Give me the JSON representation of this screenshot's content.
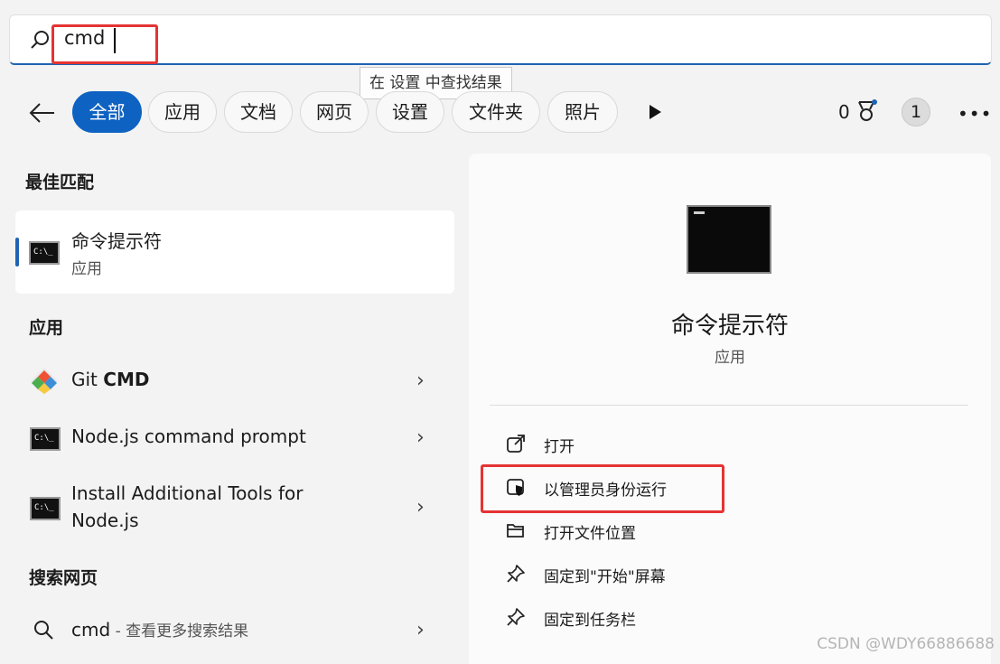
{
  "search": {
    "query": "cmd"
  },
  "tooltip": "在 设置 中查找结果",
  "filters": [
    "全部",
    "应用",
    "文档",
    "网页",
    "设置",
    "文件夹",
    "照片"
  ],
  "header": {
    "reward_count": "0",
    "avatar_label": "1"
  },
  "best_match": {
    "section_title": "最佳匹配",
    "title": "命令提示符",
    "subtitle": "应用",
    "icon_text": "C:\\_"
  },
  "apps": {
    "section_title": "应用",
    "items": [
      {
        "title_plain": "Git ",
        "title_bold": "CMD"
      },
      {
        "title_plain": "Node.js command prompt",
        "icon_text": "C:\\_"
      },
      {
        "title_line1": "Install Additional Tools for",
        "title_line2": "Node.js",
        "icon_text": "C:\\_"
      }
    ]
  },
  "web_search": {
    "section_title": "搜索网页",
    "query": "cmd",
    "suffix": " - 查看更多搜索结果"
  },
  "detail": {
    "title": "命令提示符",
    "subtitle": "应用",
    "actions": [
      "打开",
      "以管理员身份运行",
      "打开文件位置",
      "固定到\"开始\"屏幕",
      "固定到任务栏"
    ]
  },
  "watermark": "CSDN @WDY66886688",
  "colors": {
    "accent": "#0e62c2",
    "highlight_box": "#e53333"
  }
}
